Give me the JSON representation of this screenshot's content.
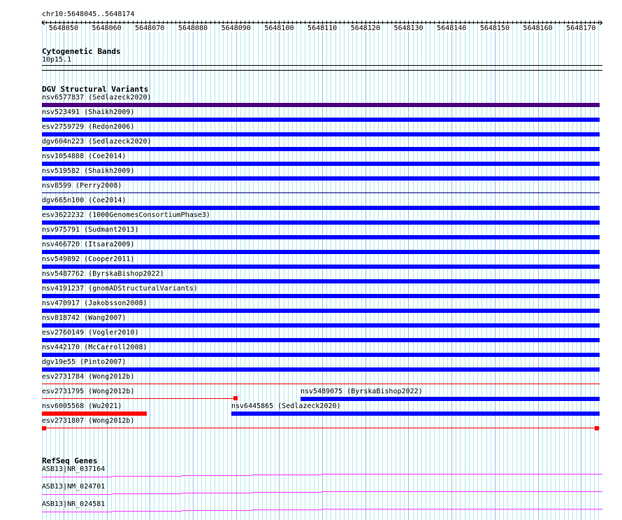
{
  "view": {
    "chrom": "chr10",
    "start": 5648045,
    "end": 5648174,
    "location_label": "chr10:5648045..5648174"
  },
  "ruler": {
    "tick_labels": [
      "5648050",
      "5648060",
      "5648070",
      "5648080",
      "5648090",
      "5648100",
      "5648110",
      "5648120",
      "5648130",
      "5648140",
      "5648150",
      "5648160",
      "5648170"
    ]
  },
  "colors": {
    "grid_minor": "#aeeaee",
    "grid_major": "#88c4e6",
    "blue": "#0000ff",
    "purple": "#4b0082",
    "red": "#ff0000",
    "magenta": "#ff33ff"
  },
  "cytobands": {
    "title": "Cytogenetic Bands",
    "band": "10p15.1"
  },
  "dgv": {
    "title": "DGV Structural Variants",
    "features": [
      {
        "label": "nsv6577837 (Sedlazeck2020)",
        "row": 0,
        "start": 5648045,
        "end": 5648174,
        "style": "thick",
        "color": "purple"
      },
      {
        "label": "nsv523491 (Shaikh2009)",
        "row": 1,
        "start": 5648045,
        "end": 5648174,
        "style": "thick",
        "color": "blue"
      },
      {
        "label": "esv2759729 (Redon2006)",
        "row": 2,
        "start": 5648045,
        "end": 5648174,
        "style": "thick",
        "color": "blue"
      },
      {
        "label": "dgv604n223 (Sedlazeck2020)",
        "row": 3,
        "start": 5648045,
        "end": 5648174,
        "style": "thick",
        "color": "blue"
      },
      {
        "label": "nsv1054888 (Coe2014)",
        "row": 4,
        "start": 5648045,
        "end": 5648174,
        "style": "thick",
        "color": "blue"
      },
      {
        "label": "nsv519582 (Shaikh2009)",
        "row": 5,
        "start": 5648045,
        "end": 5648174,
        "style": "thick",
        "color": "blue"
      },
      {
        "label": "nsv8599 (Perry2008)",
        "row": 6,
        "start": 5648045,
        "end": 5648174,
        "style": "thin",
        "color": "navy"
      },
      {
        "label": "dgv665n100 (Coe2014)",
        "row": 7,
        "start": 5648045,
        "end": 5648174,
        "style": "thick",
        "color": "blue"
      },
      {
        "label": "esv3622232 (1000GenomesConsortiumPhase3)",
        "row": 8,
        "start": 5648045,
        "end": 5648174,
        "style": "thick",
        "color": "blue"
      },
      {
        "label": "nsv975791 (Sudmant2013)",
        "row": 9,
        "start": 5648045,
        "end": 5648174,
        "style": "thick",
        "color": "blue"
      },
      {
        "label": "nsv466720 (Itsara2009)",
        "row": 10,
        "start": 5648045,
        "end": 5648174,
        "style": "thick",
        "color": "blue"
      },
      {
        "label": "nsv549892 (Cooper2011)",
        "row": 11,
        "start": 5648045,
        "end": 5648174,
        "style": "thick",
        "color": "blue"
      },
      {
        "label": "nsv5487762 (ByrskaBishop2022)",
        "row": 12,
        "start": 5648045,
        "end": 5648174,
        "style": "thick",
        "color": "blue"
      },
      {
        "label": "nsv4191237 (gnomADStructuralVariants)",
        "row": 13,
        "start": 5648045,
        "end": 5648174,
        "style": "thick",
        "color": "blue"
      },
      {
        "label": "nsv470917 (Jakobsson2008)",
        "row": 14,
        "start": 5648045,
        "end": 5648174,
        "style": "thick",
        "color": "blue"
      },
      {
        "label": "nsv818742 (Wang2007)",
        "row": 15,
        "start": 5648045,
        "end": 5648174,
        "style": "thick",
        "color": "blue"
      },
      {
        "label": "esv2760149 (Vogler2010)",
        "row": 16,
        "start": 5648045,
        "end": 5648174,
        "style": "thick",
        "color": "blue"
      },
      {
        "label": "nsv442170 (McCarroll2008)",
        "row": 17,
        "start": 5648045,
        "end": 5648174,
        "style": "thick",
        "color": "blue"
      },
      {
        "label": "dgv19e55 (Pinto2007)",
        "row": 18,
        "start": 5648045,
        "end": 5648174,
        "style": "thick",
        "color": "blue"
      },
      {
        "label": "esv2731784 (Wong2012b)",
        "row": 19,
        "start": 5648045,
        "end": 5648174,
        "style": "thin",
        "color": "red"
      },
      {
        "label": "esv2731795 (Wong2012b)",
        "row": 20,
        "start": 5648045,
        "end": 5648090,
        "style": "thin-endblock",
        "color": "red"
      },
      {
        "label": "nsv5489075 (ByrskaBishop2022)",
        "row": 20,
        "start": 5648105,
        "end": 5648174,
        "style": "thick",
        "color": "blue"
      },
      {
        "label": "nsv6005568 (Wu2021)",
        "row": 21,
        "start": 5648045,
        "end": 5648069,
        "style": "thick",
        "color": "red"
      },
      {
        "label": "nsv6445865 (Sedlazeck2020)",
        "row": 21,
        "start": 5648089,
        "end": 5648174,
        "style": "thick",
        "color": "blue"
      },
      {
        "label": "esv2731807 (Wong2012b)",
        "row": 22,
        "start": 5648045,
        "end": 5648174,
        "style": "thin-bothblocks",
        "color": "red"
      }
    ]
  },
  "refseq": {
    "title": "RefSeq Genes",
    "genes": [
      {
        "label": "ASB13|NR_037164"
      },
      {
        "label": "ASB13|NM_024701"
      },
      {
        "label": "ASB13|NR_024581"
      }
    ]
  }
}
